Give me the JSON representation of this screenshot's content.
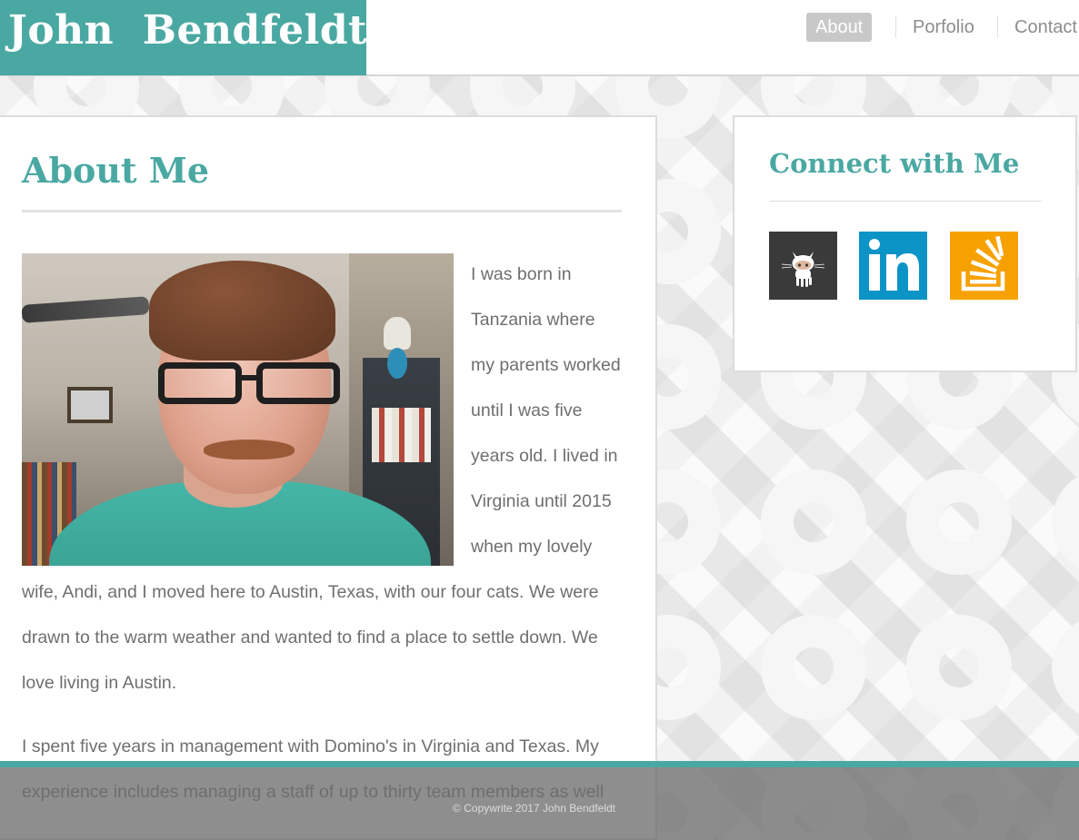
{
  "header": {
    "brand_name": "John  Bendfeldt",
    "nav": [
      {
        "label": "About",
        "active": true
      },
      {
        "label": "Porfolio",
        "active": false
      },
      {
        "label": "Contact",
        "active": false
      }
    ]
  },
  "about": {
    "title": "About Me",
    "paragraphs": [
      "I was born in Tanzania where my parents worked until I was five years old. I lived in Virginia until 2015 when my lovely wife, Andi, and I moved here to Austin, Texas, with our four cats. We were drawn to the warm weather and wanted to find a place to settle down. We love living in Austin.",
      "I spent five years in management with Domino's in Virginia and Texas. My experience includes managing a staff of up to thirty team members as well"
    ]
  },
  "connect": {
    "title": "Connect with Me",
    "links": [
      {
        "name": "GitHub",
        "icon": "github-octocat-icon",
        "color": "#3a3a3a"
      },
      {
        "name": "LinkedIn",
        "icon": "linkedin-icon",
        "color": "#0d94c6"
      },
      {
        "name": "Stack Overflow",
        "icon": "stack-overflow-icon",
        "color": "#f7a100"
      }
    ]
  },
  "footer": {
    "copyright": "© Copywrite 2017 John Bendfeldt"
  },
  "colors": {
    "accent": "#4aa8a2",
    "text": "#6f6f6f",
    "nav_active_bg": "#c8c8c8"
  }
}
